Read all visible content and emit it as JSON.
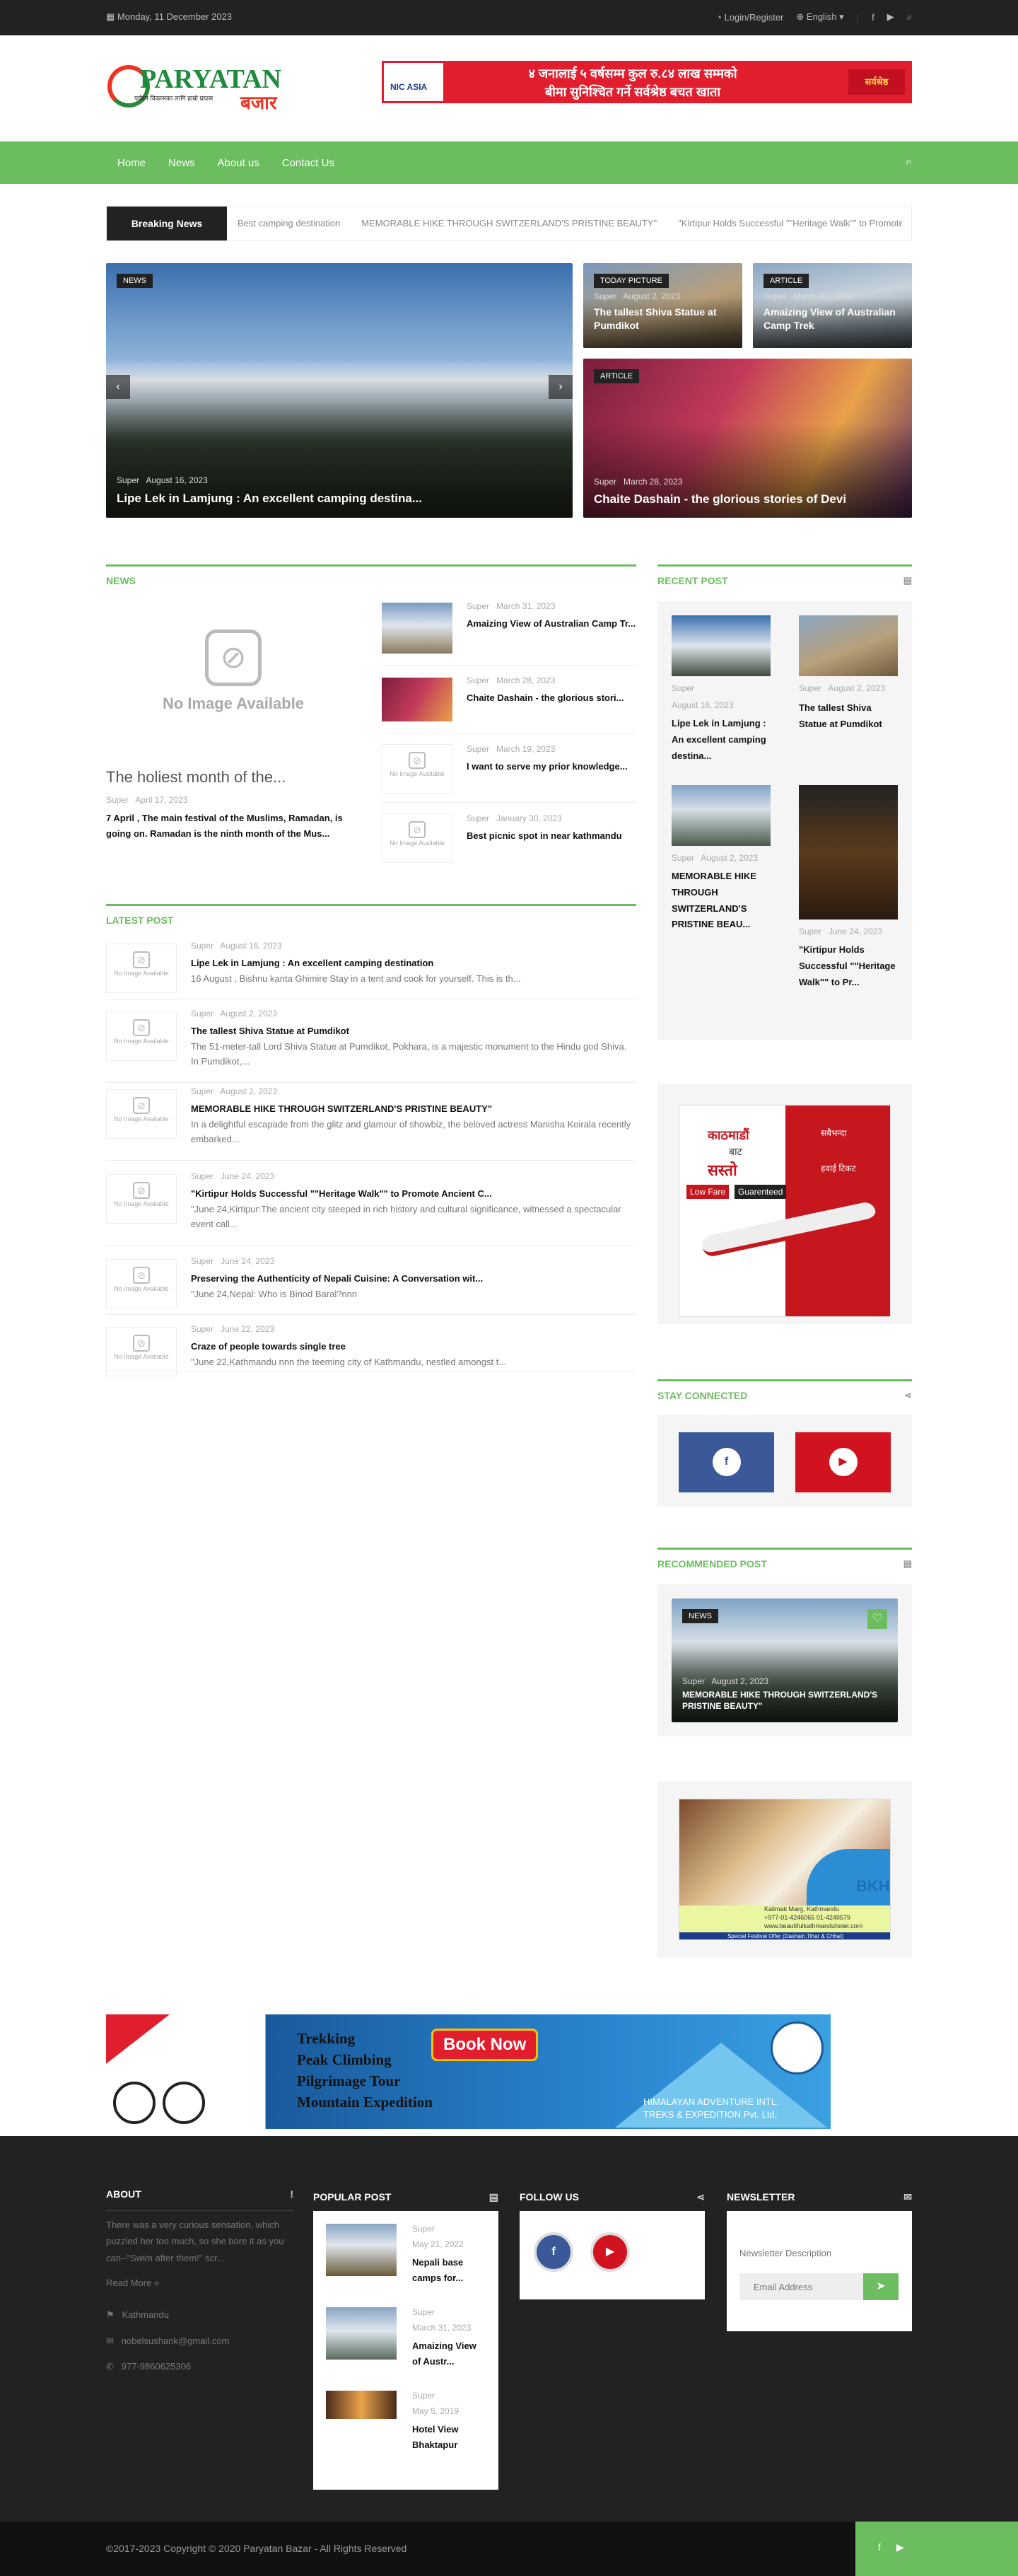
{
  "topbar": {
    "date": "Monday, 11 December 2023",
    "login": "Login/Register",
    "language": "English"
  },
  "logo": {
    "name_main": "PARYATAN",
    "name_sub": "बजार",
    "tagline": "पर्यटन विकासका लागि हाम्रो प्रयास"
  },
  "header_ad": {
    "bank": "NIC ASIA",
    "line1": "४ जनालाई ५ वर्षसम्म कुल रु.८४ लाख सम्मको",
    "line2": "बीमा सुनिश्चित गर्ने सर्वश्रेष्ठ बचत खाता",
    "brand": "सर्वश्रेष्ठ"
  },
  "nav": {
    "items": [
      "Home",
      "News",
      "About us",
      "Contact Us"
    ]
  },
  "breaking": {
    "label": "Breaking News",
    "items": [
      "Best camping destination",
      "MEMORABLE HIKE THROUGH SWITZERLAND'S PRISTINE BEAUTY\"",
      "\"Kirtipur Holds Successful \"\"Heritage Walk\"\" to Promote Anci"
    ]
  },
  "hero": {
    "main": {
      "category": "NEWS",
      "author": "Super",
      "date": "August 16, 2023",
      "title": "Lipe Lek in Lamjung : An excellent camping destina..."
    },
    "top1": {
      "category": "TODAY PICTURE",
      "author": "Super",
      "date": "August 2, 2023",
      "title": "The tallest Shiva Statue at Pumdikot"
    },
    "top2": {
      "category": "ARTICLE",
      "author": "Super",
      "date": "March 31, 2023",
      "title": "Amaizing View of Australian Camp Trek"
    },
    "bottom": {
      "category": "ARTICLE",
      "author": "Super",
      "date": "March 28, 2023",
      "title": "Chaite Dashain - the glorious stories of Devi"
    }
  },
  "news": {
    "heading": "NEWS",
    "no_image": "No Image Available",
    "feature": {
      "title": "The holiest month of the...",
      "author": "Super",
      "date": "April 17, 2023",
      "excerpt": "7 April , The main festival of the Muslims, Ramadan, is going on. Ramadan is the ninth month of the Mus..."
    },
    "list": [
      {
        "author": "Super",
        "date": "March 31, 2023",
        "title": "Amaizing View of Australian Camp Tr..."
      },
      {
        "author": "Super",
        "date": "March 28, 2023",
        "title": "Chaite Dashain - the glorious stori..."
      },
      {
        "author": "Super",
        "date": "March 19, 2023",
        "title": "I want to serve my prior knowledge..."
      },
      {
        "author": "Super",
        "date": "January 30, 2023",
        "title": "Best picnic spot in near kathmandu"
      }
    ]
  },
  "latest": {
    "heading": "LATEST POST",
    "no_image": "No Image Available",
    "items": [
      {
        "author": "Super",
        "date": "August 16, 2023",
        "title": "Lipe Lek in Lamjung : An excellent camping destination",
        "excerpt": "16 August , Bishnu kanta Ghimire Stay in a tent and cook for yourself. This is th..."
      },
      {
        "author": "Super",
        "date": "August 2, 2023",
        "title": "The tallest Shiva Statue at Pumdikot",
        "excerpt": "The 51-meter-tall Lord Shiva Statue at Pumdikot, Pokhara, is a majestic monument to the Hindu god Shiva. In Pumdikot,..."
      },
      {
        "author": "Super",
        "date": "August 2, 2023",
        "title": "MEMORABLE HIKE THROUGH SWITZERLAND'S PRISTINE BEAUTY\"",
        "excerpt": "In a delightful escapade from the glitz and glamour of showbiz, the beloved actress Manisha Koirala recently embarked..."
      },
      {
        "author": "Super",
        "date": "June 24, 2023",
        "title": "\"Kirtipur Holds Successful \"\"Heritage Walk\"\" to Promote Ancient C...",
        "excerpt": "\"June 24,Kirtipur:The ancient city steeped in rich history and cultural significance, witnessed a spectacular event call..."
      },
      {
        "author": "Super",
        "date": "June 24, 2023",
        "title": "Preserving the Authenticity of Nepali Cuisine: A Conversation wit...",
        "excerpt": "\"June 24,Nepal: Who is Binod Baral?nnn"
      },
      {
        "author": "Super",
        "date": "June 22, 2023",
        "title": "Craze of people towards single tree",
        "excerpt": "\"June 22,Kathmandu nnn the teeming city of Kathmandu, nestled amongst t..."
      }
    ]
  },
  "recent": {
    "heading": "RECENT POST",
    "items": [
      {
        "author": "Super",
        "date": "August 16, 2023",
        "title": "Lipe Lek in Lamjung : An excellent camping destina..."
      },
      {
        "author": "Super",
        "date": "August 2, 2023",
        "title": "The tallest Shiva Statue at Pumdikot"
      },
      {
        "author": "Super",
        "date": "August 2, 2023",
        "title": "MEMORABLE HIKE THROUGH SWITZERLAND'S PRISTINE BEAU..."
      },
      {
        "author": "Super",
        "date": "June 24, 2023",
        "title": "\"Kirtipur Holds Successful \"\"Heritage Walk\"\" to Pr..."
      }
    ]
  },
  "side_ad": {
    "line1": "काठमाडौं",
    "line2": "बाट",
    "line3": "सस्तो",
    "line4": "हवाई टिकट",
    "tag1": "Low Fare",
    "tag2": "Guarenteed",
    "top": "सबैभन्दा",
    "bot": "हवाई टिकट"
  },
  "stay": {
    "heading": "STAY CONNECTED"
  },
  "recommended": {
    "heading": "RECOMMENDED POST",
    "category": "NEWS",
    "author": "Super",
    "date": "August 2, 2023",
    "title": "MEMORABLE HIKE THROUGH SWITZERLAND'S PRISTINE BEAUTY\""
  },
  "hotel_ad": {
    "brand": "BKH",
    "addr": "Kalimati Marg, Kathmandu",
    "phone": "+977-01-4246065 01-4249579",
    "web": "www.beautifulkathmanduhotel.com",
    "offer": "Special Festival Offer (Dashain,Tihar & Chhat)"
  },
  "bottom_ad": {
    "items": [
      "Trekking",
      "Peak Climbing",
      "Pilgrimage Tour",
      "Mountain Expedition"
    ],
    "button": "Book Now",
    "company1": "HIMALAYAN ADVENTURE INTL.",
    "company2": "TREKS & EXPEDITION Pvt. Ltd."
  },
  "footer": {
    "about": {
      "heading": "ABOUT",
      "text": "There was a very curious sensation, which puzzled her too much, so she bore it as you can--\"Swim after them!\" scr...",
      "more": "Read More »",
      "location": "Kathmandu",
      "email": "nobelsushank@gmail.com",
      "phone": "977-9860625306"
    },
    "popular": {
      "heading": "POPULAR POST",
      "items": [
        {
          "author": "Super",
          "date": "May 21, 2022",
          "title": "Nepali base camps for..."
        },
        {
          "author": "Super",
          "date": "March 31, 2023",
          "title": "Amaizing View of Austr..."
        },
        {
          "author": "Super",
          "date": "May 5, 2019",
          "title": "Hotel View Bhaktapur"
        }
      ]
    },
    "follow": {
      "heading": "FOLLOW US"
    },
    "newsletter": {
      "heading": "NEWSLETTER",
      "desc": "Newsletter Description",
      "placeholder": "Email Address"
    }
  },
  "copyright": "©2017-2023 Copyright © 2020 Paryatan Bazar - All Rights Reserved"
}
